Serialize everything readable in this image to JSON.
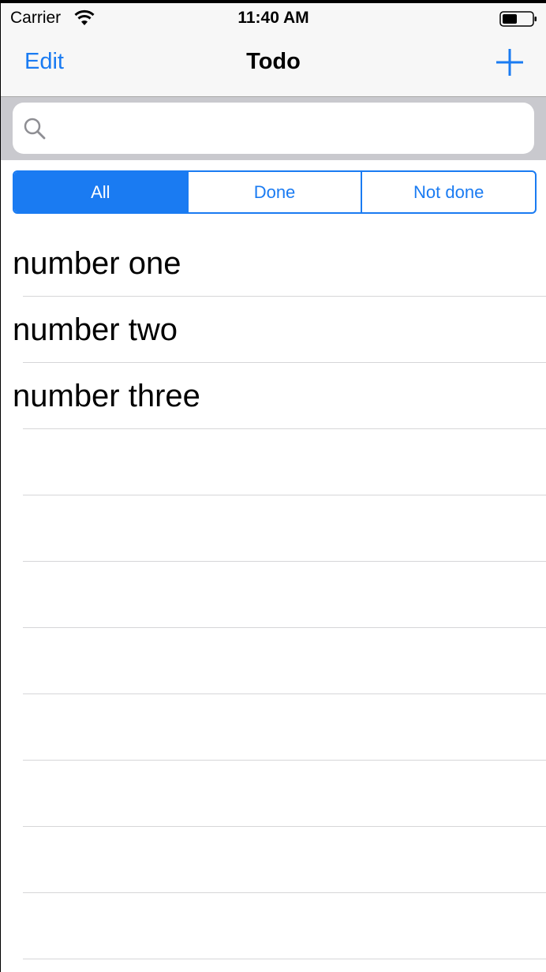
{
  "status_bar": {
    "carrier": "Carrier",
    "time": "11:40 AM",
    "wifi_icon": "wifi-icon",
    "battery_icon": "battery-icon"
  },
  "nav": {
    "edit_label": "Edit",
    "title": "Todo",
    "add_icon": "plus-icon"
  },
  "search": {
    "placeholder": "",
    "value": "",
    "icon": "search-icon"
  },
  "filter": {
    "segments": [
      "All",
      "Done",
      "Not done"
    ],
    "selected": "All"
  },
  "todos": [
    {
      "label": "number one"
    },
    {
      "label": "number two"
    },
    {
      "label": "number three"
    }
  ],
  "colors": {
    "accent": "#1a7bf2",
    "bar_bg": "#f7f7f7",
    "search_bg": "#c9c9ce",
    "separator": "#d6d6d8"
  }
}
